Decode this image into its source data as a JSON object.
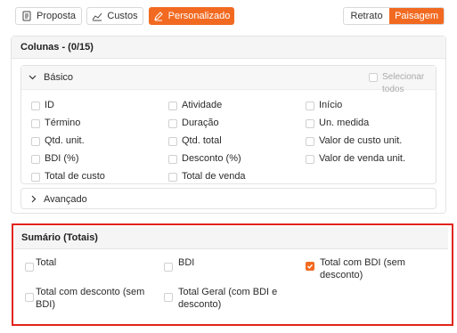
{
  "toolbar": {
    "proposta": "Proposta",
    "custos": "Custos",
    "personalizado": "Personalizado",
    "retrato": "Retrato",
    "paisagem": "Paisagem"
  },
  "colunas": {
    "title": "Colunas - (0/15)",
    "basico": {
      "title": "Básico",
      "select_all": "Selecionar todos",
      "items": [
        "ID",
        "Atividade",
        "Início",
        "Término",
        "Duração",
        "Un. medida",
        "Qtd. unit.",
        "Qtd. total",
        "Valor de custo unit.",
        "BDI (%)",
        "Desconto (%)",
        "Valor de venda unit.",
        "Total de custo",
        "Total de venda"
      ]
    },
    "avancado": {
      "title": "Avançado"
    }
  },
  "sumario": {
    "title": "Sumário (Totais)",
    "items": [
      {
        "label": "Total",
        "checked": false
      },
      {
        "label": "BDI",
        "checked": false
      },
      {
        "label_l1": "Total com BDI (sem",
        "label_l2": "desconto)",
        "checked": true
      },
      {
        "label_l1": "Total com desconto (sem",
        "label_l2": "BDI)",
        "checked": false
      },
      {
        "label_l1": "Total Geral (com BDI e",
        "label_l2": "desconto)",
        "checked": false
      }
    ]
  },
  "colors": {
    "accent": "#f26a21",
    "highlight": "#e0251b"
  }
}
